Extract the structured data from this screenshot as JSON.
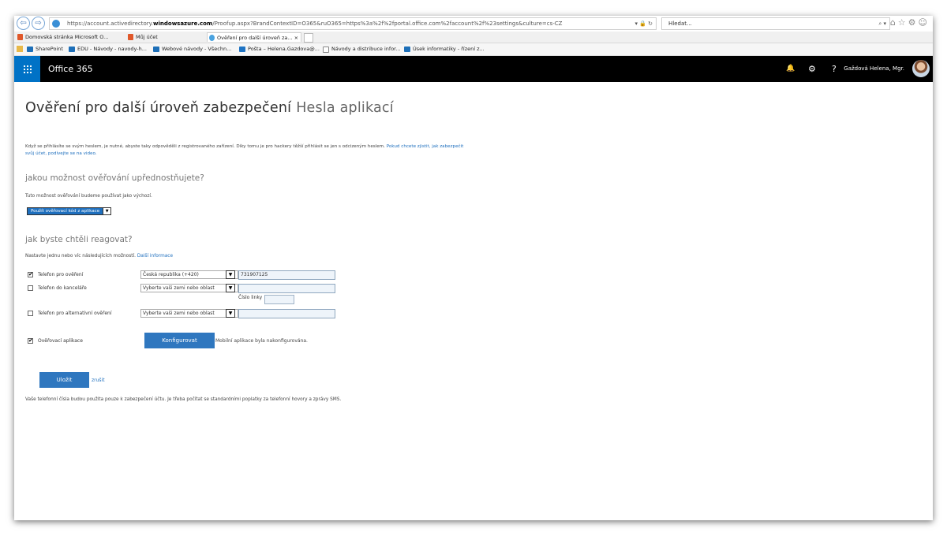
{
  "browser": {
    "back_glyph": "⇦",
    "forward_glyph": "⇨",
    "url_prefix": "https://account.activedirectory.",
    "url_domain": "windowsazure.com",
    "url_rest": "/Proofup.aspx?BrandContextID=O365&ruO365=https%3a%2f%2fportal.office.com%2faccount%2f%23settings&culture=cs-CZ",
    "url_tools": "▾ 🔒 ↻",
    "search_placeholder": "Hledat...",
    "search_tools": "⌕ ▾",
    "top_icons": "⌂☆⚙☺"
  },
  "tabs": [
    {
      "label": "Domovská stránka Microsoft O..."
    },
    {
      "label": "Můj účet"
    },
    {
      "label": "Ověření pro další úroveň za...  ×"
    }
  ],
  "favorites": [
    {
      "label": "SharePoint"
    },
    {
      "label": "EDU - Návody - navody-h..."
    },
    {
      "label": "Webové návody - Všechn..."
    },
    {
      "label": "Pošta – Helena.Gazdova@..."
    },
    {
      "label": "Návody a distribuce infor..."
    },
    {
      "label": "Úsek informatiky - řízení z..."
    }
  ],
  "o365": {
    "app_title": "Office 365",
    "bell_glyph": "🔔",
    "gear_glyph": "⚙",
    "help_glyph": "?",
    "user_name": "Gaždová Helena, Mgr."
  },
  "page": {
    "title": "Ověření pro další úroveň zabezpečení",
    "title_tab": "Hesla aplikací",
    "intro_text": "Když se přihlásíte se svým heslem, je nutné, abyste taky odpověděli z registrovaného zařízení. Díky tomu je pro hackery těžší přihlásit se jen s odcizeným heslem. ",
    "intro_link": "Pokud chcete zjistit, jak zabezpečit svůj účet, podívejte se na video.",
    "q1_heading": "jakou možnost ověřování upřednostňujete?",
    "q1_help": "Tuto možnost ověřování budeme používat jako výchozí.",
    "method_selected": "Použít ověřovací kód z aplikace",
    "q2_heading": "jak byste chtěli reagovat?",
    "q2_help": "Nastavte jednu nebo víc následujících možností. ",
    "q2_link": "Další informace",
    "options": [
      {
        "label": "Telefon pro ověření",
        "checked": "✔",
        "country": "Česká republika (+420)",
        "number": "731907125"
      },
      {
        "label": "Telefon do kanceláře",
        "checked": "",
        "country": "Vyberte vaši zemi nebo oblast",
        "number": ""
      },
      {
        "label": "Telefon pro alternativní ověření",
        "checked": "",
        "country": "Vyberte vaši zemi nebo oblast",
        "number": ""
      }
    ],
    "extension_label": "Číslo linky",
    "app_option": {
      "label": "Ověřovací aplikace",
      "checked": "✔"
    },
    "configure_button": "Konfigurovat",
    "configured_msg": "Mobilní aplikace byla nakonfigurována.",
    "save_button": "Uložit",
    "cancel_link": "zrušit",
    "footer_note": "Vaše telefonní čísla budou použita pouze k zabezpečení účtu. Je třeba počítat se standardními poplatky za telefonní hovory a zprávy SMS."
  }
}
